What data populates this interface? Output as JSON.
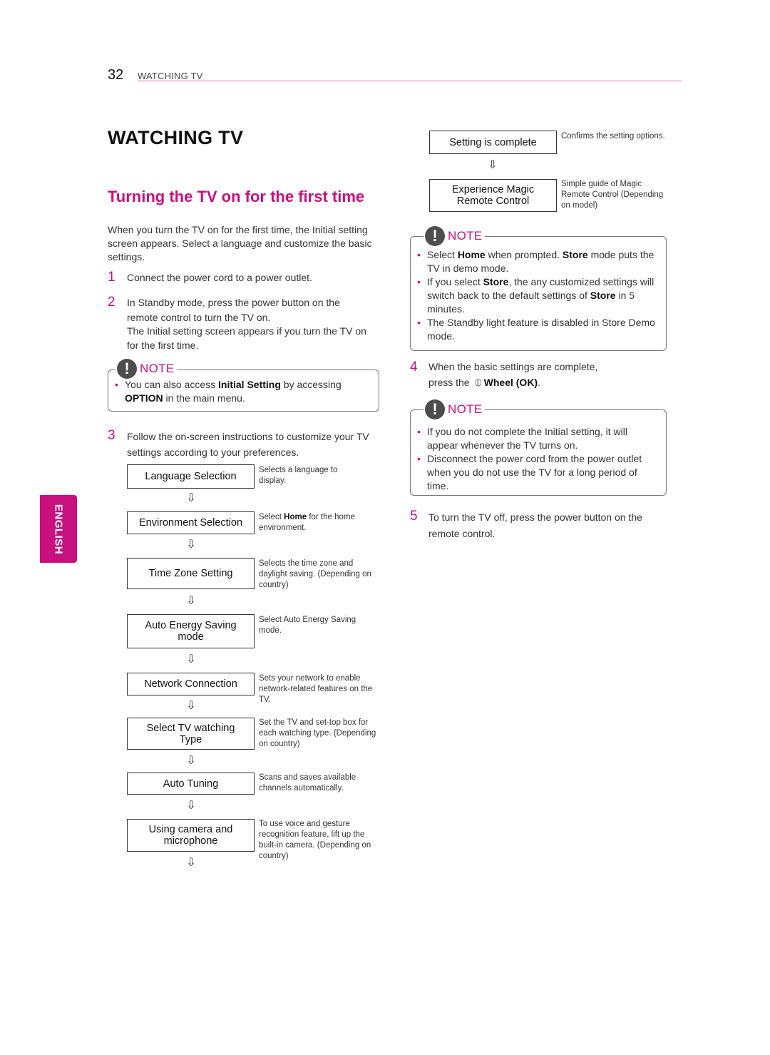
{
  "header": {
    "page_number": "32",
    "section": "WATCHING TV"
  },
  "title": "WATCHING TV",
  "section_title": "Turning the TV on for the first time",
  "intro": "When you turn the TV on for the first time, the Initial setting screen appears. Select a language and customize the basic settings.",
  "steps": [
    {
      "num": "1",
      "text": "Connect the power cord to a power outlet."
    },
    {
      "num": "2",
      "text": "In Standby mode, press the power button on the remote control to turn the TV on.",
      "subtext": "The Initial setting screen appears if you turn the TV on for the first time."
    },
    {
      "num": "3",
      "text": "Follow the on-screen instructions to customize your TV settings according to your preferences."
    },
    {
      "num": "4",
      "text_a": "When the basic settings are complete,",
      "text_b": "press the",
      "icon": "wheel-icon",
      "bold": "Wheel (OK)",
      "end": "."
    },
    {
      "num": "5",
      "text": "To turn the TV off, press the power button on the remote control."
    }
  ],
  "note_label": "NOTE",
  "note1": {
    "items": [
      {
        "pre": "You can also access ",
        "b1": "Initial Setting",
        "mid": " by accessing ",
        "b2": "OPTION",
        "post": " in the main menu."
      }
    ]
  },
  "note2": {
    "items": [
      {
        "pre": "Select ",
        "b1": "Home",
        "mid": " when prompted. ",
        "b2": "Store",
        "post": " mode puts the TV in demo mode."
      },
      {
        "pre": "If you select ",
        "b1": "Store",
        "mid": ", the any customized settings will switch back to the default settings of ",
        "b2": "Store",
        "post": " in 5 minutes."
      },
      {
        "pre": "The Standby light feature is disabled in Store Demo mode.",
        "b1": "",
        "mid": "",
        "b2": "",
        "post": ""
      }
    ]
  },
  "note3": {
    "items": [
      {
        "text": "If you do not complete the Initial setting, it will appear whenever the TV turns on."
      },
      {
        "text": "Disconnect the power cord from the power outlet when you do not use the TV for a long period of time."
      }
    ]
  },
  "flow": [
    {
      "label": "Language Selection",
      "desc": "Selects a language to display."
    },
    {
      "label": "Environment Selection",
      "desc_pre": "Select ",
      "desc_bold": "Home",
      "desc_post": " for the home environment."
    },
    {
      "label": "Time Zone Setting",
      "desc": "Selects the time zone and daylight saving. (Depending on country)"
    },
    {
      "label": "Auto Energy Saving mode",
      "desc": "Select Auto Energy Saving mode."
    },
    {
      "label": "Network Connection",
      "desc": "Sets your network to enable network-related features on the TV."
    },
    {
      "label": "Select TV watching Type",
      "desc": "Set the TV and set-top box for each watching type. (Depending on country)"
    },
    {
      "label": "Auto Tuning",
      "desc": "Scans and saves available channels automatically."
    },
    {
      "label": "Using camera and microphone",
      "desc": "To use voice and gesture recognition feature, lift up the built-in camera. (Depending on country)"
    },
    {
      "label": "Setting is complete",
      "desc": "Confirms the setting options."
    },
    {
      "label": "Experience Magic Remote Control",
      "desc": "Simple guide of Magic Remote Control (Depending on model)"
    }
  ],
  "arrow_glyph": "⇩",
  "language_tab": "ENGLISH",
  "colors": {
    "accent": "#c8107f",
    "rule": "#e36cb8"
  }
}
